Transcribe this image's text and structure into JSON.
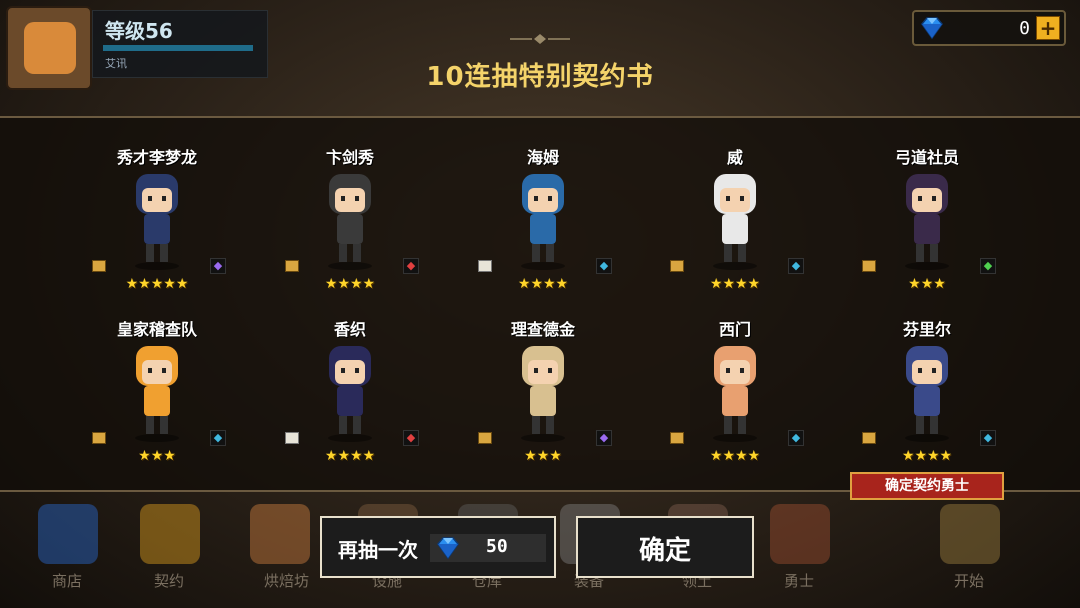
{
  "player": {
    "level_label": "等级56",
    "sub_label": "艾讯"
  },
  "currency": {
    "gems": "0"
  },
  "title": "10连抽特别契约书",
  "heroes": [
    {
      "name": "秀才李梦龙",
      "stars": "★★★★★",
      "stars_count": 5,
      "scroll": "gold",
      "type_icon": "staff-icon",
      "type_color": "#9a6af0"
    },
    {
      "name": "卞剑秀",
      "stars": "★★★★",
      "stars_count": 4,
      "scroll": "gold",
      "type_icon": "sword-icon",
      "type_color": "#e04040"
    },
    {
      "name": "海姆",
      "stars": "★★★★",
      "stars_count": 4,
      "scroll": "white",
      "type_icon": "shield-icon",
      "type_color": "#40b8e0"
    },
    {
      "name": "威",
      "stars": "★★★★",
      "stars_count": 4,
      "scroll": "gold",
      "type_icon": "shield-icon",
      "type_color": "#40b8e0"
    },
    {
      "name": "弓道社员",
      "stars": "★★★",
      "stars_count": 3,
      "scroll": "gold",
      "type_icon": "bow-icon",
      "type_color": "#50d050"
    },
    {
      "name": "皇家稽查队",
      "stars": "★★★",
      "stars_count": 3,
      "scroll": "gold",
      "type_icon": "shield-icon",
      "type_color": "#40b8e0"
    },
    {
      "name": "香织",
      "stars": "★★★★",
      "stars_count": 4,
      "scroll": "white",
      "type_icon": "sword-icon",
      "type_color": "#e04040"
    },
    {
      "name": "理查德金",
      "stars": "★★★",
      "stars_count": 3,
      "scroll": "gold",
      "type_icon": "staff-icon",
      "type_color": "#9a6af0"
    },
    {
      "name": "西门",
      "stars": "★★★★",
      "stars_count": 4,
      "scroll": "gold",
      "type_icon": "shield-icon",
      "type_color": "#40b8e0"
    },
    {
      "name": "芬里尔",
      "stars": "★★★★",
      "stars_count": 4,
      "scroll": "gold",
      "type_icon": "shield-icon",
      "type_color": "#40b8e0"
    }
  ],
  "badge": "确定契约勇士",
  "buttons": {
    "redraw_label": "再抽一次",
    "redraw_cost": "50",
    "confirm_label": "确定"
  },
  "bottom_nav": [
    "商店",
    "契约",
    "烘焙坊",
    "设施",
    "仓库",
    "装备",
    "领土",
    "勇士",
    "开始"
  ]
}
